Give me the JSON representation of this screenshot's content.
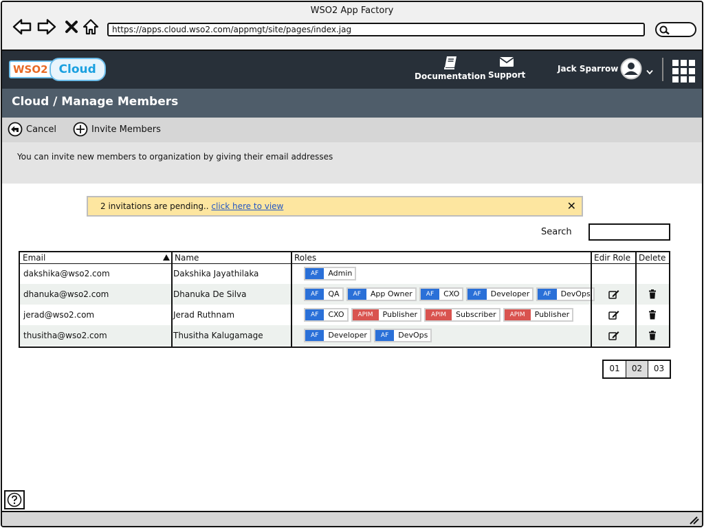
{
  "window": {
    "title": "WSO2 App Factory"
  },
  "browser": {
    "url": "https://apps.cloud.wso2.com/appmgt/site/pages/index.jag"
  },
  "header": {
    "logo_wso2": "WSO2",
    "logo_cloud": "Cloud",
    "documentation_label": "Documentation",
    "support_label": "Support",
    "user_name": "Jack Sparrow"
  },
  "page": {
    "title": "Cloud / Manage Members"
  },
  "toolbar": {
    "cancel_label": "Cancel",
    "invite_label": "Invite Members"
  },
  "info": {
    "text": "You can invite new members to organization by giving their email addresses"
  },
  "banner": {
    "text": "2 invitations are pending.. ",
    "link": "click here to view",
    "close": "✕"
  },
  "search": {
    "label": "Search",
    "value": ""
  },
  "table": {
    "headers": {
      "email": "Email",
      "name": "Name",
      "roles": "Roles",
      "edit_role": "Edir Role",
      "delete": "Delete"
    },
    "sort_column": "Email",
    "rows": [
      {
        "email": "dakshika@wso2.com",
        "name": "Dakshika Jayathilaka",
        "editable": false,
        "roles": [
          {
            "src": "AF",
            "role": "Admin"
          }
        ]
      },
      {
        "email": "dhanuka@wso2.com",
        "name": "Dhanuka De Silva",
        "editable": true,
        "roles": [
          {
            "src": "AF",
            "role": "QA"
          },
          {
            "src": "AF",
            "role": "App Owner"
          },
          {
            "src": "AF",
            "role": "CXO"
          },
          {
            "src": "AF",
            "role": "Developer"
          },
          {
            "src": "AF",
            "role": "DevOps"
          }
        ]
      },
      {
        "email": "jerad@wso2.com",
        "name": "Jerad Ruthnam",
        "editable": true,
        "roles": [
          {
            "src": "AF",
            "role": "CXO"
          },
          {
            "src": "APIM",
            "role": "Publisher"
          },
          {
            "src": "APIM",
            "role": "Subscriber"
          },
          {
            "src": "APIM",
            "role": "Publisher"
          }
        ]
      },
      {
        "email": "thusitha@wso2.com",
        "name": "Thusitha Kalugamage",
        "editable": true,
        "roles": [
          {
            "src": "AF",
            "role": "Developer"
          },
          {
            "src": "AF",
            "role": "DevOps"
          }
        ]
      }
    ]
  },
  "pagination": {
    "pages": [
      "01",
      "02",
      "03"
    ],
    "current": "02"
  },
  "colors": {
    "header_bg": "#283039",
    "title_bg": "#4f5d6a",
    "af_tag": "#2a70d8",
    "apim_tag": "#d9534f",
    "banner_bg": "#fde6a0",
    "link": "#2557c4"
  }
}
